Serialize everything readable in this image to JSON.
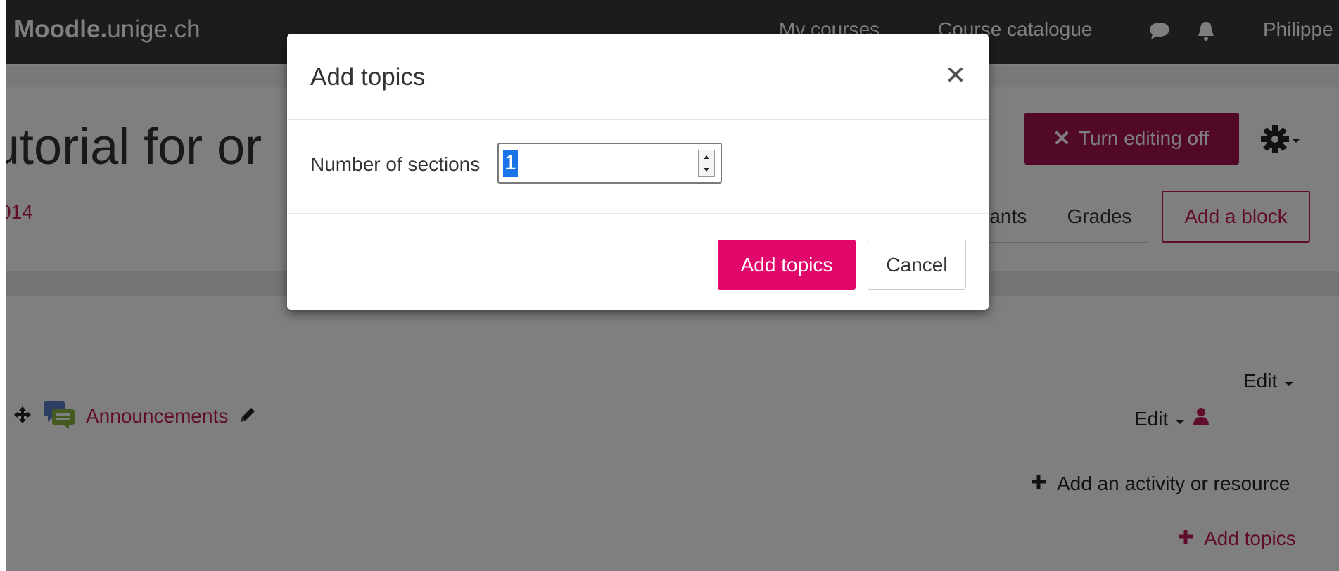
{
  "navbar": {
    "brand_bold": "Moodle.",
    "brand_rest": "unige.ch",
    "links": [
      "My courses",
      "Course catalogue"
    ],
    "user_name": "Philippe",
    "background": "#393939"
  },
  "course": {
    "title": "utorial for or",
    "subtitle": "014",
    "edit_toggle_label": "Turn editing off",
    "tabs": [
      "pants",
      "Grades"
    ],
    "add_block_label": "Add a block"
  },
  "section": {
    "edit_label": "Edit",
    "activity_name": "Announcements",
    "activity_edit_label": "Edit",
    "add_activity_label": "Add an activity or resource",
    "add_topics_label": "Add topics"
  },
  "modal": {
    "title": "Add topics",
    "field_label": "Number of sections",
    "field_value": "1",
    "primary_label": "Add topics",
    "cancel_label": "Cancel"
  },
  "colors": {
    "accent": "#e2076a",
    "brand_dark": "#a4104f",
    "link": "#c2185b"
  },
  "icons": {
    "close": "close-icon",
    "gear": "gear-icon",
    "chat": "chat-icon",
    "bell": "bell-icon",
    "move": "move-icon",
    "forum": "forum-icon",
    "pencil": "pencil-icon",
    "user": "user-icon",
    "plus": "plus-icon"
  }
}
